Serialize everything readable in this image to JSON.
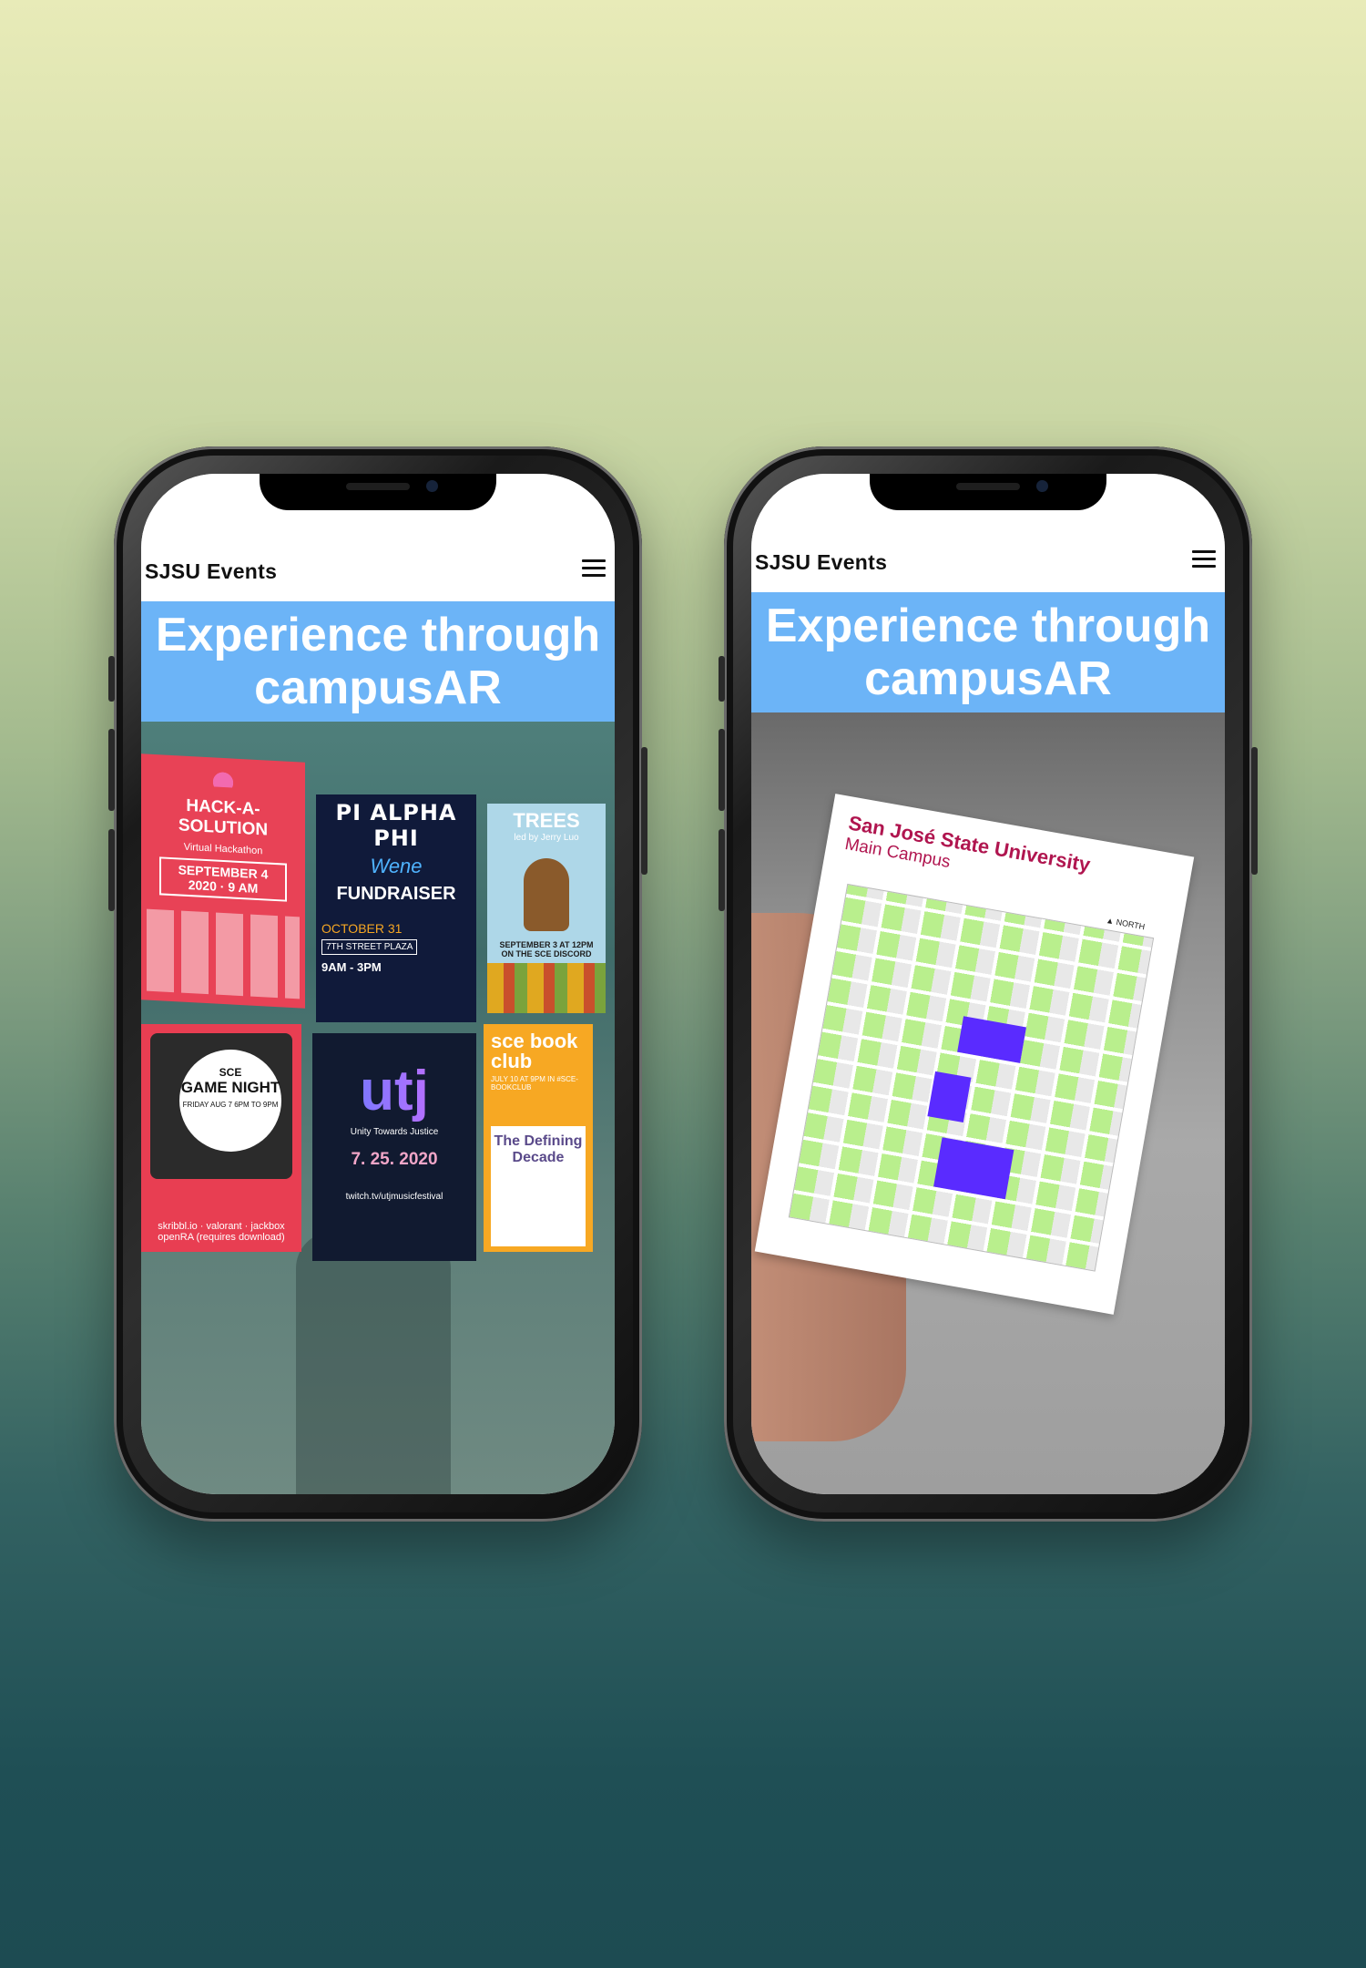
{
  "phones": [
    {
      "brand": "SJSU Events",
      "banner_line1": "Experience through",
      "banner_line2": "campusAR",
      "posters": {
        "hack": {
          "title": "HACK-A-SOLUTION",
          "subtitle": "Virtual Hackathon",
          "date": "SEPTEMBER 4 2020 · 9 AM"
        },
        "pi": {
          "title": "PI ALPHA PHI",
          "script": "Wene",
          "event": "FUNDRAISER",
          "date": "OCTOBER 31",
          "location": "7TH STREET PLAZA",
          "time": "9AM - 3PM"
        },
        "trees": {
          "title": "TREES",
          "subtitle": "led by Jerry Luo",
          "date": "SEPTEMBER 3 AT 12PM ON THE SCE DISCORD"
        },
        "game": {
          "org": "SCE",
          "title": "GAME NIGHT",
          "date": "FRIDAY AUG 7 6PM TO 9PM",
          "games": "skribbl.io · valorant · jackbox openRA (requires download)"
        },
        "utj": {
          "title": "utj",
          "subtitle": "Unity Towards Justice",
          "date": "7. 25. 2020",
          "url": "twitch.tv/utjmusicfestival"
        },
        "book": {
          "title": "sce book club",
          "date": "JULY 10 AT 9PM IN #SCE-BOOKCLUB",
          "book": "The Defining Decade"
        }
      }
    },
    {
      "brand": "SJSU Events",
      "banner_line1": "Experience through",
      "banner_line2": "campusAR",
      "map": {
        "title": "San José State University",
        "subtitle": "Main Campus",
        "north": "NORTH"
      }
    }
  ],
  "colors": {
    "banner": "#6cb4f7",
    "map_accent": "#b0154f",
    "building": "#5a2bff"
  }
}
